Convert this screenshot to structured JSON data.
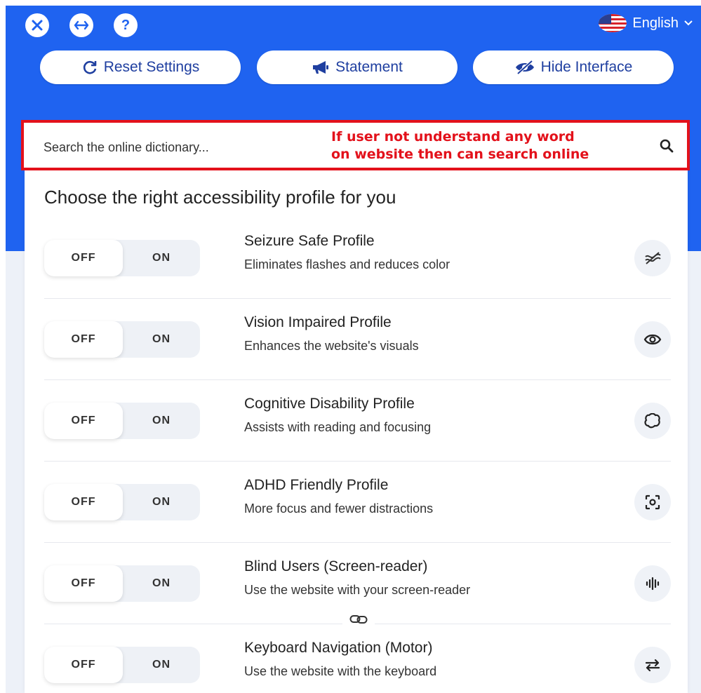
{
  "header": {
    "language": "English"
  },
  "actions": {
    "reset_label": "Reset Settings",
    "statement_label": "Statement",
    "hide_label": "Hide Interface"
  },
  "search": {
    "placeholder": "Search the online dictionary...",
    "annotation_line1": "If user not understand any word",
    "annotation_line2": "on website then can search online"
  },
  "profiles_heading": "Choose the right accessibility profile for you",
  "toggle": {
    "off": "OFF",
    "on": "ON"
  },
  "profiles": [
    {
      "title": "Seizure Safe Profile",
      "desc": "Eliminates flashes and reduces color",
      "icon": "wave-icon"
    },
    {
      "title": "Vision Impaired Profile",
      "desc": "Enhances the website's visuals",
      "icon": "eye-icon"
    },
    {
      "title": "Cognitive Disability Profile",
      "desc": "Assists with reading and focusing",
      "icon": "brain-icon"
    },
    {
      "title": "ADHD Friendly Profile",
      "desc": "More focus and fewer distractions",
      "icon": "focus-icon"
    },
    {
      "title": "Blind Users (Screen-reader)",
      "desc": "Use the website with your screen-reader",
      "icon": "audio-wave-icon"
    },
    {
      "title": "Keyboard Navigation (Motor)",
      "desc": "Use the website with the keyboard",
      "icon": "arrows-icon"
    }
  ],
  "colors": {
    "brand_blue": "#1f63f0",
    "annotation_red": "#e3111b"
  }
}
